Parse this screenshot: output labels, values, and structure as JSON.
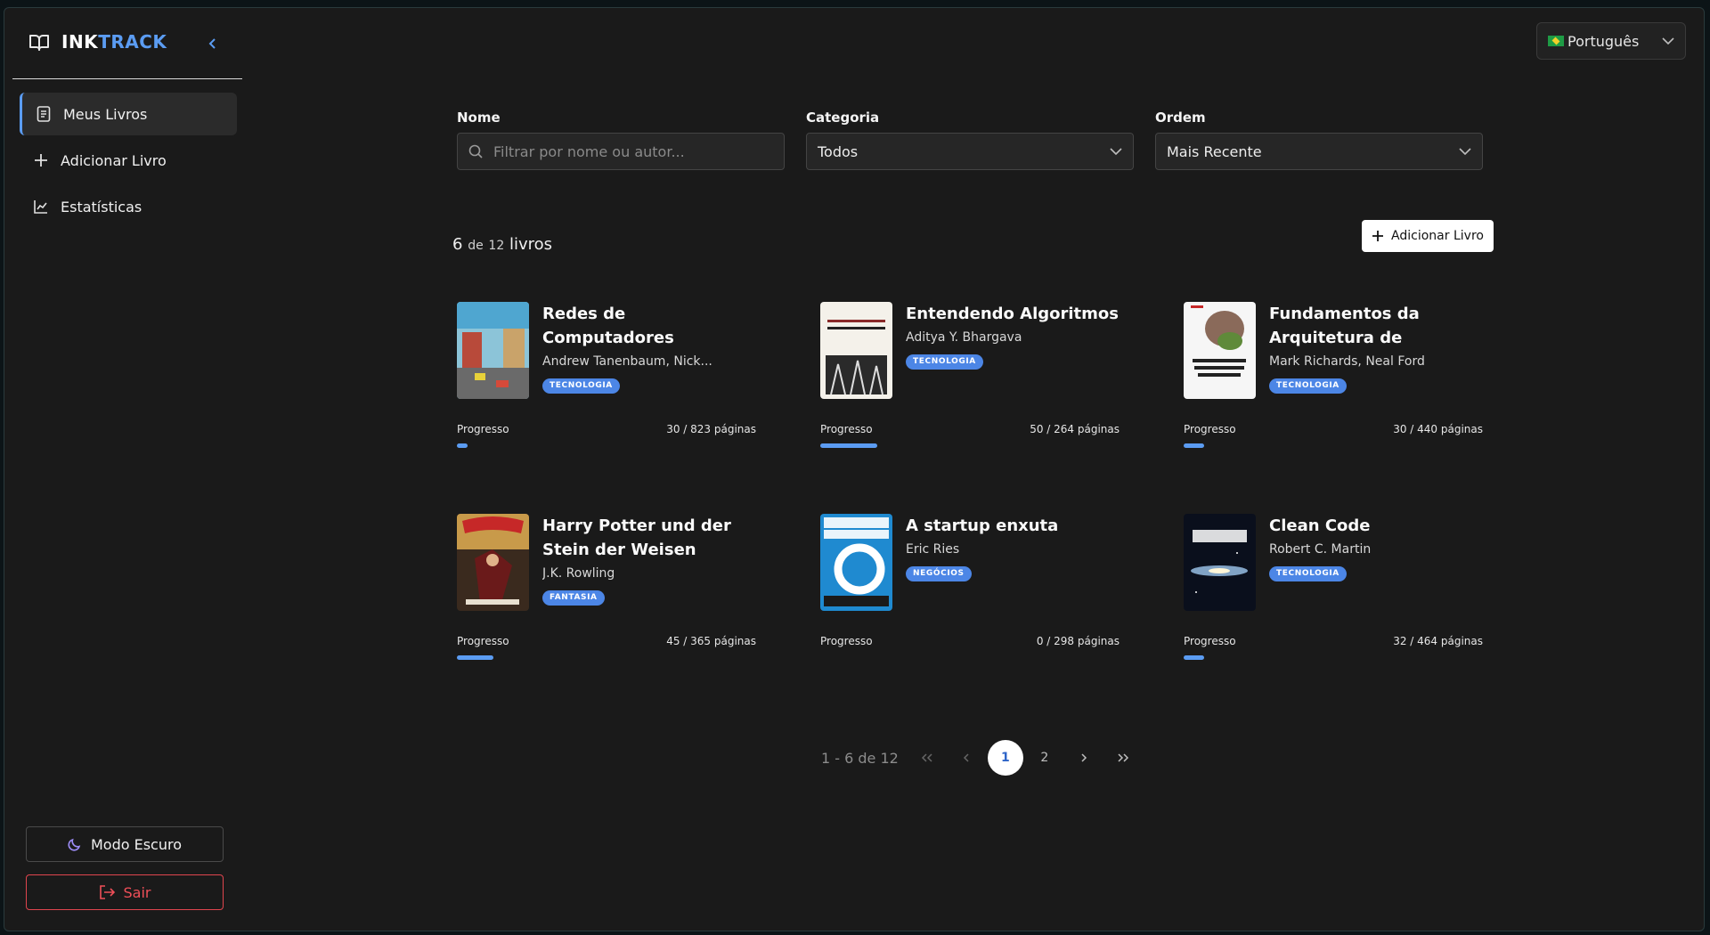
{
  "brand": {
    "part1": "INK",
    "part2": "TRACK"
  },
  "sidebar": {
    "items": [
      {
        "label": "Meus Livros",
        "icon": "book-list-icon",
        "active": true
      },
      {
        "label": "Adicionar Livro",
        "icon": "plus-icon",
        "active": false
      },
      {
        "label": "Estatísticas",
        "icon": "chart-line-icon",
        "active": false
      }
    ],
    "dark_mode_label": "Modo Escuro",
    "logout_label": "Sair"
  },
  "language": {
    "selected": "Português",
    "flag": "brazil-flag-icon"
  },
  "filters": {
    "name_label": "Nome",
    "name_placeholder": "Filtrar por nome ou autor...",
    "category_label": "Categoria",
    "category_value": "Todos",
    "order_label": "Ordem",
    "order_value": "Mais Recente"
  },
  "summary": {
    "shown": "6",
    "of": "de",
    "total": "12",
    "unit": "livros"
  },
  "add_button_label": "Adicionar Livro",
  "progress_label": "Progresso",
  "books": [
    {
      "title": "Redes de Computadores (coedição Bookman e...",
      "author": "Andrew Tanenbaum, Nick...",
      "category": "TECNOLOGIA",
      "pages": "30 / 823 páginas",
      "progress": 0.036
    },
    {
      "title": "Entendendo Algoritmos",
      "author": "Aditya Y. Bhargava",
      "category": "TECNOLOGIA",
      "pages": "50 / 264 páginas",
      "progress": 0.189
    },
    {
      "title": "Fundamentos da Arquitetura de Software ...",
      "author": "Mark Richards, Neal Ford",
      "category": "TECNOLOGIA",
      "pages": "30 / 440 páginas",
      "progress": 0.068
    },
    {
      "title": "Harry Potter und der Stein der Weisen",
      "author": "J.K. Rowling",
      "category": "FANTASIA",
      "pages": "45 / 365 páginas",
      "progress": 0.123
    },
    {
      "title": "A startup enxuta",
      "author": "Eric Ries",
      "category": "NEGÓCIOS",
      "pages": "0 / 298 páginas",
      "progress": 0
    },
    {
      "title": "Clean Code",
      "author": "Robert C. Martin",
      "category": "TECNOLOGIA",
      "pages": "32 / 464 páginas",
      "progress": 0.069
    }
  ],
  "pagination": {
    "range": "1 - 6 de 12",
    "pages": [
      "1",
      "2"
    ],
    "current": "1"
  },
  "colors": {
    "accent": "#5b9cf2",
    "danger": "#ef4f58",
    "background": "#1a1a1a"
  }
}
